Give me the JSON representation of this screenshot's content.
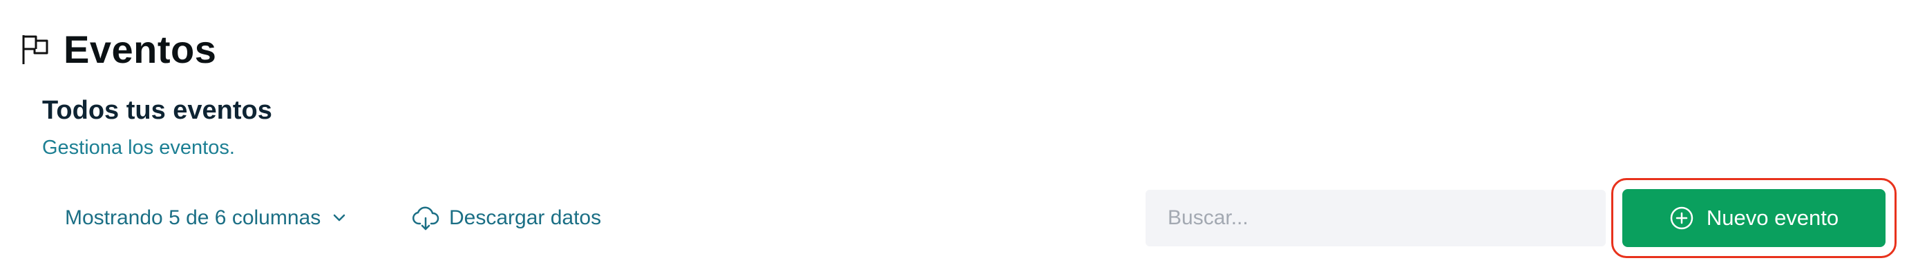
{
  "header": {
    "icon": "flag-icon",
    "title": "Eventos"
  },
  "section": {
    "title": "Todos tus eventos",
    "subtitle": "Gestiona los eventos."
  },
  "toolbar": {
    "columns_label": "Mostrando 5 de 6 columnas",
    "columns_icon": "chevron-down-icon",
    "download_label": "Descargar datos",
    "download_icon": "cloud-download-icon",
    "search_placeholder": "Buscar...",
    "search_value": "",
    "new_event_label": "Nuevo evento",
    "new_event_icon": "plus-circle-icon"
  },
  "colors": {
    "accent_green": "#0aa05e",
    "link_teal": "#1b6f85",
    "highlight_red": "#e8321c"
  }
}
